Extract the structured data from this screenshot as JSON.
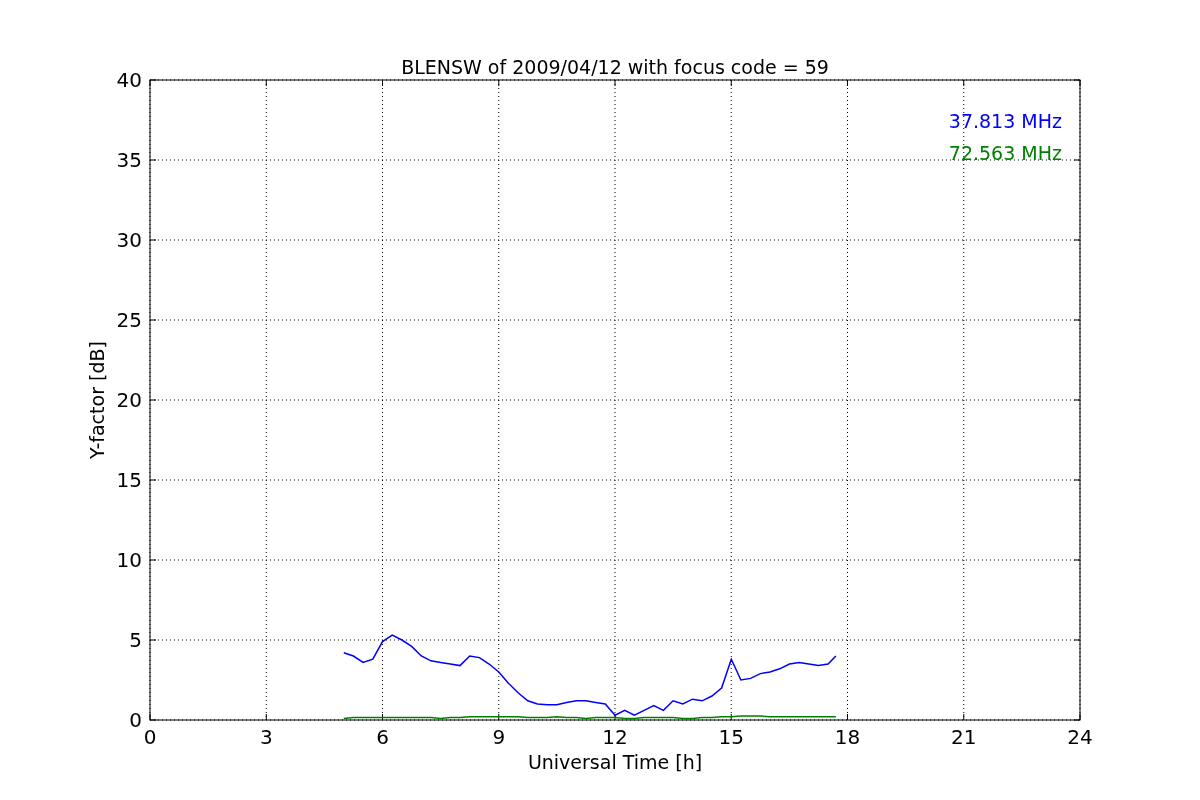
{
  "chart_data": {
    "type": "line",
    "title": "BLENSW of 2009/04/12 with focus code = 59",
    "xlabel": "Universal Time [h]",
    "ylabel": "Y-factor [dB]",
    "x": [
      5.0,
      5.25,
      5.5,
      5.75,
      6.0,
      6.25,
      6.5,
      6.75,
      7.0,
      7.25,
      7.5,
      7.75,
      8.0,
      8.25,
      8.5,
      8.75,
      9.0,
      9.25,
      9.5,
      9.75,
      10.0,
      10.25,
      10.5,
      10.75,
      11.0,
      11.25,
      11.5,
      11.75,
      12.0,
      12.25,
      12.5,
      12.75,
      13.0,
      13.25,
      13.5,
      13.75,
      14.0,
      14.25,
      14.5,
      14.75,
      15.0,
      15.25,
      15.5,
      15.75,
      16.0,
      16.25,
      16.5,
      16.75,
      17.0,
      17.25,
      17.5,
      17.7
    ],
    "series": [
      {
        "name": "37.813 MHz",
        "color": "#0000ff",
        "values": [
          4.2,
          4.0,
          3.6,
          3.8,
          4.9,
          5.3,
          5.0,
          4.6,
          4.0,
          3.7,
          3.6,
          3.5,
          3.4,
          4.0,
          3.9,
          3.5,
          3.0,
          2.3,
          1.7,
          1.2,
          1.0,
          0.95,
          0.95,
          1.1,
          1.2,
          1.2,
          1.1,
          1.0,
          0.3,
          0.6,
          0.3,
          0.6,
          0.9,
          0.6,
          1.2,
          1.0,
          1.3,
          1.2,
          1.5,
          2.0,
          3.8,
          2.5,
          2.6,
          2.9,
          3.0,
          3.2,
          3.5,
          3.6,
          3.5,
          3.4,
          3.5,
          4.0
        ]
      },
      {
        "name": "72.563 MHz",
        "color": "#008000",
        "values": [
          0.1,
          0.15,
          0.15,
          0.15,
          0.15,
          0.15,
          0.15,
          0.15,
          0.15,
          0.15,
          0.1,
          0.15,
          0.15,
          0.2,
          0.2,
          0.2,
          0.2,
          0.2,
          0.2,
          0.15,
          0.15,
          0.15,
          0.2,
          0.15,
          0.15,
          0.1,
          0.15,
          0.15,
          0.15,
          0.1,
          0.1,
          0.15,
          0.15,
          0.15,
          0.15,
          0.1,
          0.1,
          0.15,
          0.15,
          0.2,
          0.2,
          0.25,
          0.25,
          0.25,
          0.2,
          0.2,
          0.2,
          0.2,
          0.2,
          0.2,
          0.2,
          0.2
        ]
      }
    ],
    "xlim": [
      0,
      24
    ],
    "ylim": [
      0,
      40
    ],
    "xticks": [
      0,
      3,
      6,
      9,
      12,
      15,
      18,
      21,
      24
    ],
    "yticks": [
      0,
      5,
      10,
      15,
      20,
      25,
      30,
      35,
      40
    ],
    "grid": true
  }
}
